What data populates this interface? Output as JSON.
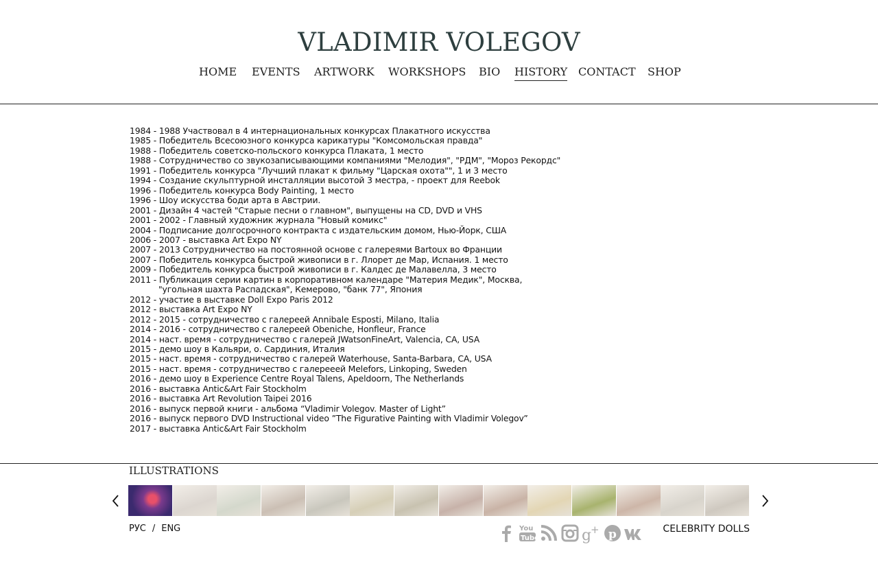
{
  "site": {
    "title": "VLADIMIR VOLEGOV"
  },
  "nav": {
    "items": [
      "HOME",
      "EVENTS",
      "ARTWORK",
      "WORKSHOPS",
      "BIO",
      "HISTORY",
      "CONTACT",
      "SHOP"
    ],
    "active": "HISTORY"
  },
  "history": {
    "lines": [
      "1984 - 1988 Участвовал в 4 интернациональных конкурсах Плакатного искусства",
      "1985 - Победитель Всесоюзного конкурса карикатуры \"Комсомольская правда\"",
      "1988 - Победитель советско-польского конкурса Плаката, 1 место",
      "1988 - Сотрудничество со звукозаписывающими компаниями \"Мелодия\", \"РДМ\", \"Мороз Рекордс\"",
      "1991 - Победитель конкурса \"Лучший плакат к фильму \"Царская охота\"\", 1 и 3 место",
      "1994 - Создание скульптурной инсталляции высотой 3 местра, - проект для Reebok",
      "1996 - Победитель конкурса Body Painting, 1 место",
      "1996 - Шоу искусства боди арта в Австрии.",
      "2001 - Дизайн 4 частей \"Старые песни о главном\", выпущены на CD, DVD и VHS",
      "2001 - 2002 - Главный художник журнала \"Новый комикс\"",
      "2004 - Подписание долгосрочного контракта с издательским домом, Нью-Йорк, США",
      "2006 - 2007 - выставка Art Expo NY",
      "2007 - 2013 Сотрудничество на постоянной основе с галереями Bartoux во Франции",
      "2007 - Победитель конкурса быстрой живописи в г. Ллорет де Мар, Испания. 1 место",
      "2009 - Победитель конкурса быстрой живописи в г. Калдес де Малавелла, 3 место",
      "2011 - Публикация серии картин в корпоративном календаре \"Материя Медик\", Москва,",
      "\"угольная шахта Распадская\", Кемерово, \"банк 77\", Япония",
      "2012 - участие в выставке Doll Expo Paris 2012",
      "2012 - выставка Art Expo NY",
      "2012 - 2015 - сотрудничество с галереей Annibale Esposti, Milano, Italia",
      "2014 - 2016 - сотрудничество с галереей Obeniche, Honfleur, France",
      "2014 - наст. время - сотрудничество с галерей JWatsonFineArt, Valencia, CA, USA",
      "2015 - демо шоу в Кальяри, о. Сардиния, Италия",
      "2015 - наст. время - сотрудничество с галерей Waterhouse, Santa-Barbara, CA, USA",
      "2015 - наст. время - сотрудничество с галерееей Melefors, Linkoping, Sweden",
      "2016 - демо шоу в Experience Centre Royal Talens, Apeldoorn, The Netherlands",
      "2016 - выставка Antic&Art Fair Stockholm",
      "2016 - выставка Art Revolution Taipei 2016",
      "2016 - выпуск первой книги - альбома “Vladimir Volegov. Master of Light”",
      "2016 - выпуск первого DVD Instructional video ”The Figurative Painting with Vladimir Volegov”",
      "2017 - выставка Antic&Art Fair Stockholm"
    ]
  },
  "illustrations": {
    "title": "ILLUSTRATIONS",
    "thumb_colors": [
      "#5b2f6e",
      "#dcd6d0",
      "#d4d8cc",
      "#cbbfb4",
      "#c9c7bd",
      "#d6cfb7",
      "#c8c2b0",
      "#c7b2a9",
      "#c9b3a6",
      "#e3d6b4",
      "#a8b36e",
      "#cdb6a8",
      "#d8d4cc",
      "#cfc9c0"
    ]
  },
  "footer": {
    "lang_ru": "РУС",
    "lang_sep": "/",
    "lang_en": "ENG",
    "social_icons": [
      "facebook-icon",
      "youtube-icon",
      "rss-icon",
      "instagram-icon",
      "google-plus-icon",
      "pinterest-icon",
      "vk-icon"
    ],
    "celebrity_link": "CELEBRITY DOLLS"
  }
}
